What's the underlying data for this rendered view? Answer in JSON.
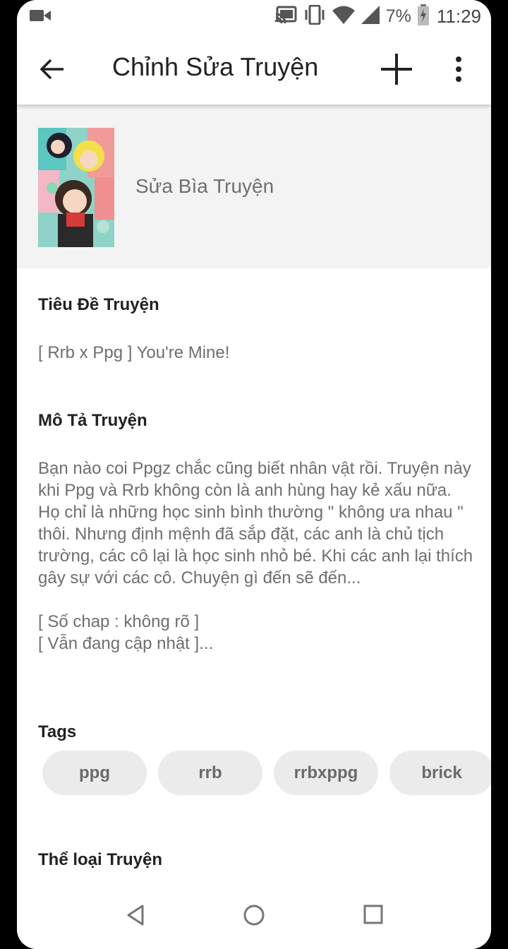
{
  "status_bar": {
    "battery_percent": "7%",
    "time": "11:29",
    "icons": [
      "video-camera-icon",
      "cast-icon",
      "vibrate-icon",
      "wifi-icon",
      "cellular-signal-icon",
      "battery-charging-icon"
    ]
  },
  "app_bar": {
    "title": "Chỉnh Sửa Truyện",
    "icons": [
      "back-arrow-icon",
      "plus-icon",
      "more-vertical-icon"
    ]
  },
  "cover": {
    "label": "Sửa Bìa Truyện"
  },
  "story_title": {
    "label": "Tiêu Đề Truyện",
    "value": "[ Rrb x Ppg ] You're Mine!"
  },
  "description": {
    "label": "Mô Tả Truyện",
    "paragraph": "Bạn nào coi Ppgz chắc cũng biết nhân vật rồi. Truyện này khi Ppg và Rrb không còn là anh hùng hay kẻ xấu nữa. Họ chỉ là những học sinh bình thường \" không ưa nhau \" thôi. Nhưng định mệnh đã sắp đặt, các anh là chủ tịch trường, các cô lại là học sinh nhỏ bé. Khi các anh lại thích gây sự với các cô. Chuyện gì đến sẽ đến...",
    "line_1": "[ Số chap : không rõ ]",
    "line_2": "[ Vẫn đang cập nhật ]..."
  },
  "tags": {
    "label": "Tags",
    "items": [
      "ppg",
      "rrb",
      "rrbxppg",
      "brick"
    ]
  },
  "genre": {
    "label": "Thể loại Truyện"
  },
  "nav_bar": {
    "icons": [
      "nav-back-icon",
      "nav-home-icon",
      "nav-recents-icon"
    ]
  }
}
